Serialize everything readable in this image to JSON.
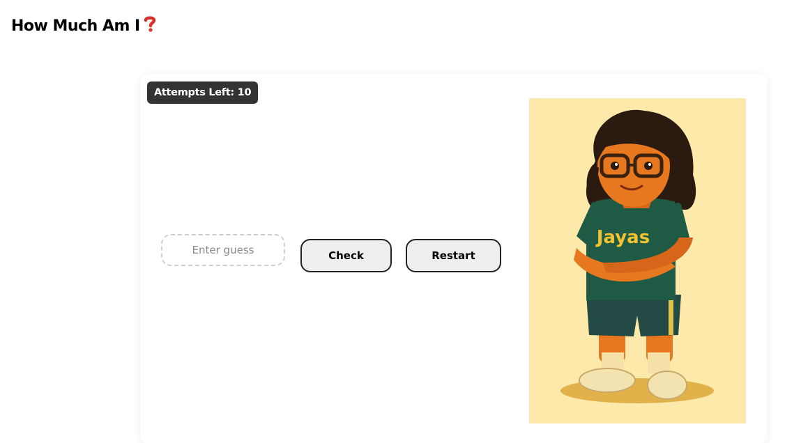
{
  "header": {
    "title": "How Much Am I",
    "title_icon": "red-question-mark-icon"
  },
  "game": {
    "attempts_label": "Attempts Left: 10",
    "guess_input": {
      "placeholder": "Enter guess",
      "value": ""
    },
    "check_label": "Check",
    "restart_label": "Restart",
    "image": {
      "shirt_text": "Jayas",
      "background_color": "#fde9aa",
      "shirt_color": "#1f5a44",
      "shirt_text_color": "#f2c230"
    }
  },
  "colors": {
    "badge_bg": "#333333",
    "button_bg": "#eeeeee",
    "button_border": "#222222",
    "question_mark": "#d9302c"
  }
}
